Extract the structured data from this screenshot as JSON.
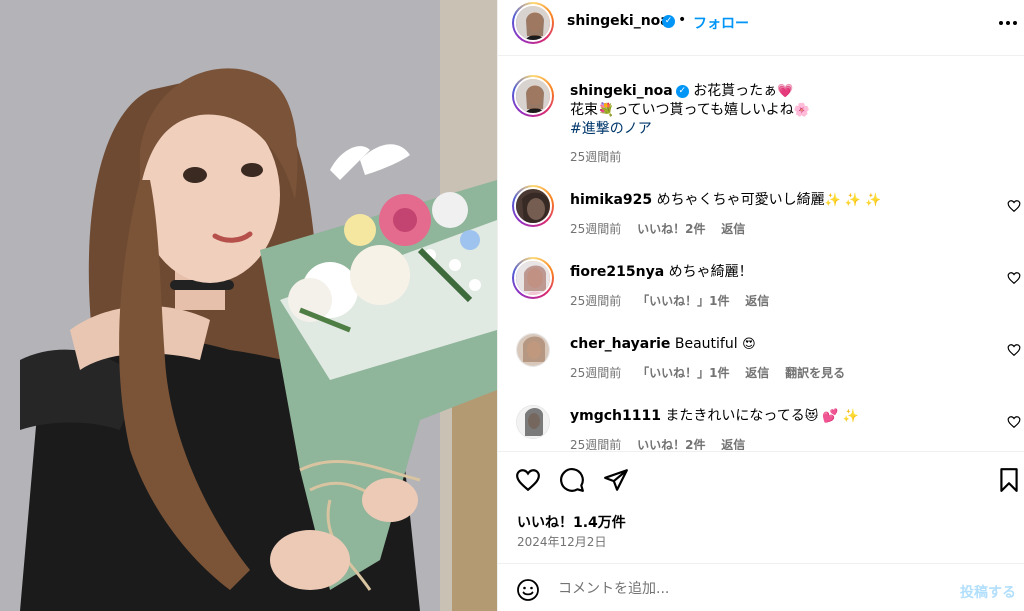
{
  "post": {
    "username": "shingeki_noa",
    "follow_label": "フォロー",
    "dot": "•",
    "verified_glyph": "✓",
    "caption": {
      "line1": "お花貰ったぁ",
      "line1_emoji": "💗",
      "line2a": "花束",
      "line2_emoji1": "💐",
      "line2b": "っていつ貰っても嬉しいよね",
      "line2_emoji2": "🌸",
      "hashtag": "#進撃のノア",
      "time": "25週間前"
    },
    "likes": "いいね！1.4万件",
    "date": "2024年12月2日"
  },
  "comments": [
    {
      "username": "himika925",
      "text": "めちゃくちゃ可愛いし綺麗",
      "emoji": "✨ ✨ ✨",
      "time": "25週間前",
      "likes": "いいね！2件",
      "reply": "返信"
    },
    {
      "username": "fiore215nya",
      "text": "めちゃ綺麗！",
      "emoji": "",
      "time": "25週間前",
      "likes": "「いいね！」1件",
      "reply": "返信"
    },
    {
      "username": "cher_hayarie",
      "text": "Beautiful",
      "emoji": "😍",
      "time": "25週間前",
      "likes": "「いいね！」1件",
      "reply": "返信",
      "translate": "翻訳を見る"
    },
    {
      "username": "ymgch1111",
      "text": "またきれいになってる",
      "emoji": "😻 💕 ✨",
      "time": "25週間前",
      "likes": "いいね！2件",
      "reply": "返信"
    }
  ],
  "comment_box": {
    "placeholder": "コメントを追加...",
    "post_label": "投稿する"
  },
  "icons": [
    "more-icon",
    "heart-icon",
    "comment-icon",
    "share-icon",
    "bookmark-icon",
    "emoji-icon",
    "verified-icon"
  ],
  "colors": {
    "accent": "#0095f6",
    "meta": "#737373",
    "hashtag": "#00376b",
    "post_disabled": "#b2dffc"
  }
}
